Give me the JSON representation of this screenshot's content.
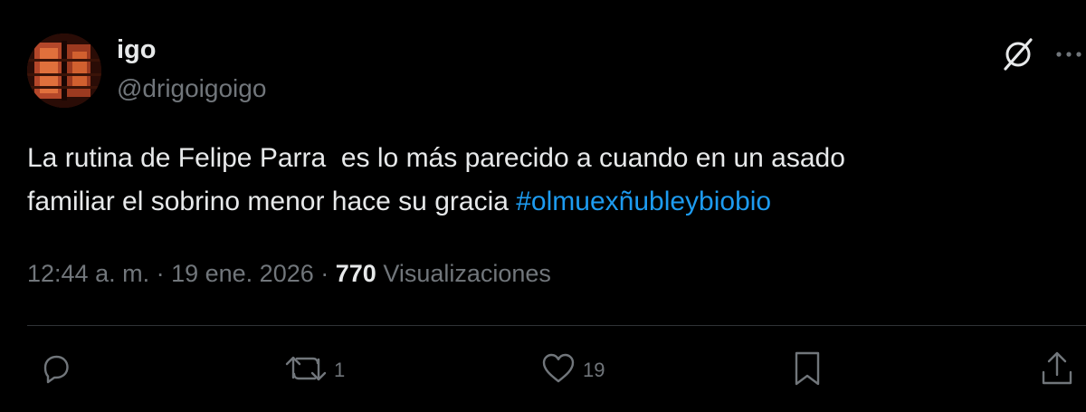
{
  "author": {
    "display_name": "igo",
    "handle": "@drigoigoigo"
  },
  "tweet": {
    "text_main": "La rutina de Felipe Parra  es lo más parecido a cuando en un asado\nfamiliar el sobrino menor hace su gracia ",
    "hashtag": "#olmuexñubleybiobio"
  },
  "meta": {
    "time": "12:44 a. m.",
    "separator1": " · ",
    "date": "19 ene. 2026",
    "separator2": " · ",
    "views_count": "770",
    "views_label": " Visualizaciones"
  },
  "actions": {
    "reply_count": "",
    "retweet_count": "1",
    "like_count": "19"
  },
  "icons": {
    "grok": "grok-icon",
    "more": "more-icon",
    "reply": "reply-icon",
    "retweet": "retweet-icon",
    "like": "heart-icon",
    "bookmark": "bookmark-icon",
    "share": "share-icon"
  },
  "colors": {
    "background": "#000000",
    "text": "#e7e9ea",
    "secondary": "#71767b",
    "link": "#1d9bf0",
    "divider": "#2f3336"
  }
}
